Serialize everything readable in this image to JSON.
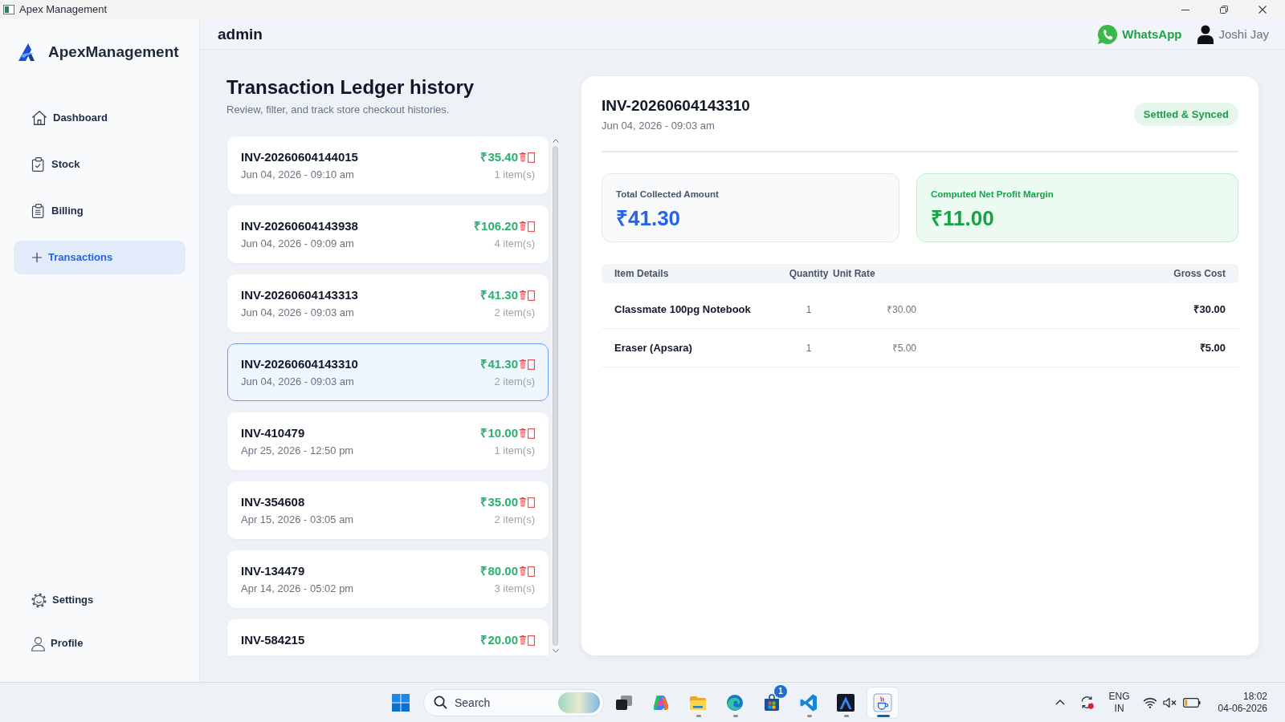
{
  "window": {
    "title": "Apex Management"
  },
  "sidebar": {
    "brand": "ApexManagement",
    "items": [
      {
        "kind": "dashboard",
        "label": "Dashboard",
        "selected": false
      },
      {
        "kind": "stock",
        "label": "Stock",
        "selected": false
      },
      {
        "kind": "billing",
        "label": "Billing",
        "selected": false
      },
      {
        "kind": "transactions",
        "label": "Transactions",
        "selected": true
      }
    ],
    "footer_items": [
      {
        "kind": "settings",
        "label": "Settings",
        "selected": false
      },
      {
        "kind": "profile",
        "label": "Profile",
        "selected": false
      }
    ]
  },
  "header": {
    "title": "admin",
    "whatsapp": "WhatsApp",
    "user": "Joshi Jay"
  },
  "ledger": {
    "title": "Transaction Ledger history",
    "subtitle": "Review, filter, and track store checkout histories.",
    "transactions": [
      {
        "id": "INV-20260604144015",
        "date": "Jun 04, 2026 - 09:10 am",
        "amount": "₹35.40",
        "items": "1 item(s)",
        "selected": false
      },
      {
        "id": "INV-20260604143938",
        "date": "Jun 04, 2026 - 09:09 am",
        "amount": "₹106.20",
        "items": "4 item(s)",
        "selected": false
      },
      {
        "id": "INV-20260604143313",
        "date": "Jun 04, 2026 - 09:03 am",
        "amount": "₹41.30",
        "items": "2 item(s)",
        "selected": false
      },
      {
        "id": "INV-20260604143310",
        "date": "Jun 04, 2026 - 09:03 am",
        "amount": "₹41.30",
        "items": "2 item(s)",
        "selected": true
      },
      {
        "id": "INV-410479",
        "date": "Apr 25, 2026 - 12:50 pm",
        "amount": "₹10.00",
        "items": "1 item(s)",
        "selected": false
      },
      {
        "id": "INV-354608",
        "date": "Apr 15, 2026 - 03:05 am",
        "amount": "₹35.00",
        "items": "2 item(s)",
        "selected": false
      },
      {
        "id": "INV-134479",
        "date": "Apr 14, 2026 - 05:02 pm",
        "amount": "₹80.00",
        "items": "3 item(s)",
        "selected": false
      },
      {
        "id": "INV-584215",
        "amount": "₹20.00",
        "selected": false
      }
    ]
  },
  "detail": {
    "invoice": "INV-20260604143310",
    "date": "Jun 04, 2026 - 09:03 am",
    "status": "Settled & Synced",
    "summary": [
      {
        "kind": "total",
        "label": "Total Collected Amount",
        "value": "₹41.30"
      },
      {
        "kind": "profit",
        "label": "Computed Net Profit Margin",
        "value": "₹11.00"
      }
    ],
    "table": {
      "columns": [
        "Item Details",
        "Quantity",
        "Unit Rate",
        "Gross Cost"
      ],
      "rows": [
        [
          "Classmate 100pg Notebook",
          "1",
          "₹30.00",
          "₹30.00"
        ],
        [
          "Eraser (Apsara)",
          "1",
          "₹5.00",
          "₹5.00"
        ]
      ]
    }
  },
  "taskbar": {
    "search": {
      "placeholder": "Search"
    },
    "apps": [
      {
        "kind": "taskview",
        "running": false,
        "selected": false
      },
      {
        "kind": "copilot",
        "running": false,
        "selected": false
      },
      {
        "kind": "explorer",
        "running": true,
        "selected": false
      },
      {
        "kind": "edge",
        "running": true,
        "selected": false
      },
      {
        "kind": "store",
        "running": false,
        "selected": false,
        "badge": "1"
      },
      {
        "kind": "vscode",
        "running": true,
        "selected": false
      },
      {
        "kind": "apex",
        "running": true,
        "selected": false
      },
      {
        "kind": "java",
        "running": true,
        "selected": true
      }
    ],
    "tray": {
      "language": "ENG",
      "region": "IN",
      "time": "18:02",
      "date": "04-06-2026"
    }
  }
}
